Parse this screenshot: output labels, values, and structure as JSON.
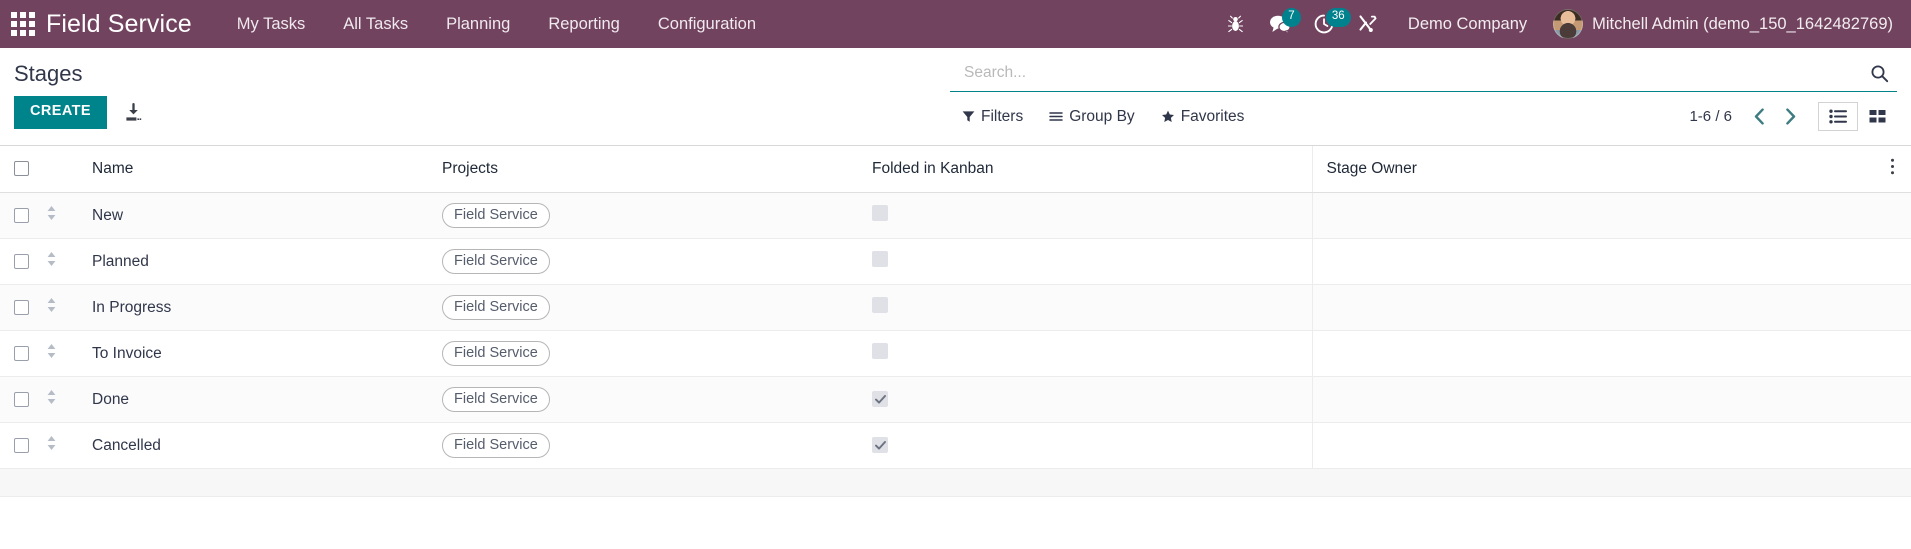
{
  "navbar": {
    "apps_icon": "apps-grid-icon",
    "brand": "Field Service",
    "menu_items": [
      {
        "label": "My Tasks",
        "name": "menu-my-tasks"
      },
      {
        "label": "All Tasks",
        "name": "menu-all-tasks"
      },
      {
        "label": "Planning",
        "name": "menu-planning"
      },
      {
        "label": "Reporting",
        "name": "menu-reporting"
      },
      {
        "label": "Configuration",
        "name": "menu-configuration"
      }
    ],
    "sys_icons": [
      {
        "name": "bug-icon",
        "badge": ""
      },
      {
        "name": "messages-icon",
        "badge": "7"
      },
      {
        "name": "activities-clock-icon",
        "badge": "36"
      },
      {
        "name": "tools-icon",
        "badge": ""
      }
    ],
    "company": "Demo Company",
    "user": "Mitchell Admin (demo_150_1642482769)",
    "bg_color": "#71435f",
    "badge_color": "#00828e"
  },
  "control_panel": {
    "title": "Stages",
    "create_label": "CREATE",
    "create_color": "#00848c",
    "import_icon": "import-download-icon",
    "search": {
      "placeholder": "Search...",
      "value": "",
      "icon": "search-icon"
    },
    "facets": [
      {
        "label": "Filters",
        "icon": "filter-funnel-icon",
        "name": "filters-dropdown"
      },
      {
        "label": "Group By",
        "icon": "group-by-lines-icon",
        "name": "group-by-dropdown"
      },
      {
        "label": "Favorites",
        "icon": "favorites-star-icon",
        "name": "favorites-dropdown"
      }
    ],
    "pager": {
      "range": "1-6 / 6",
      "prev_icon": "chevron-left-icon",
      "next_icon": "chevron-right-icon"
    },
    "views": [
      {
        "name": "view-list",
        "icon": "list-view-icon",
        "active": true
      },
      {
        "name": "view-kanban",
        "icon": "kanban-view-icon",
        "active": false
      }
    ]
  },
  "table": {
    "columns": [
      {
        "key": "name",
        "label": "Name"
      },
      {
        "key": "projects",
        "label": "Projects"
      },
      {
        "key": "folded",
        "label": "Folded in Kanban"
      },
      {
        "key": "owner",
        "label": "Stage Owner"
      }
    ],
    "optional_columns_icon": "vertical-dots-icon",
    "rows": [
      {
        "name": "New",
        "projects": "Field Service",
        "folded": false,
        "owner": ""
      },
      {
        "name": "Planned",
        "projects": "Field Service",
        "folded": false,
        "owner": ""
      },
      {
        "name": "In Progress",
        "projects": "Field Service",
        "folded": false,
        "owner": ""
      },
      {
        "name": "To Invoice",
        "projects": "Field Service",
        "folded": false,
        "owner": ""
      },
      {
        "name": "Done",
        "projects": "Field Service",
        "folded": true,
        "owner": ""
      },
      {
        "name": "Cancelled",
        "projects": "Field Service",
        "folded": true,
        "owner": ""
      }
    ]
  }
}
